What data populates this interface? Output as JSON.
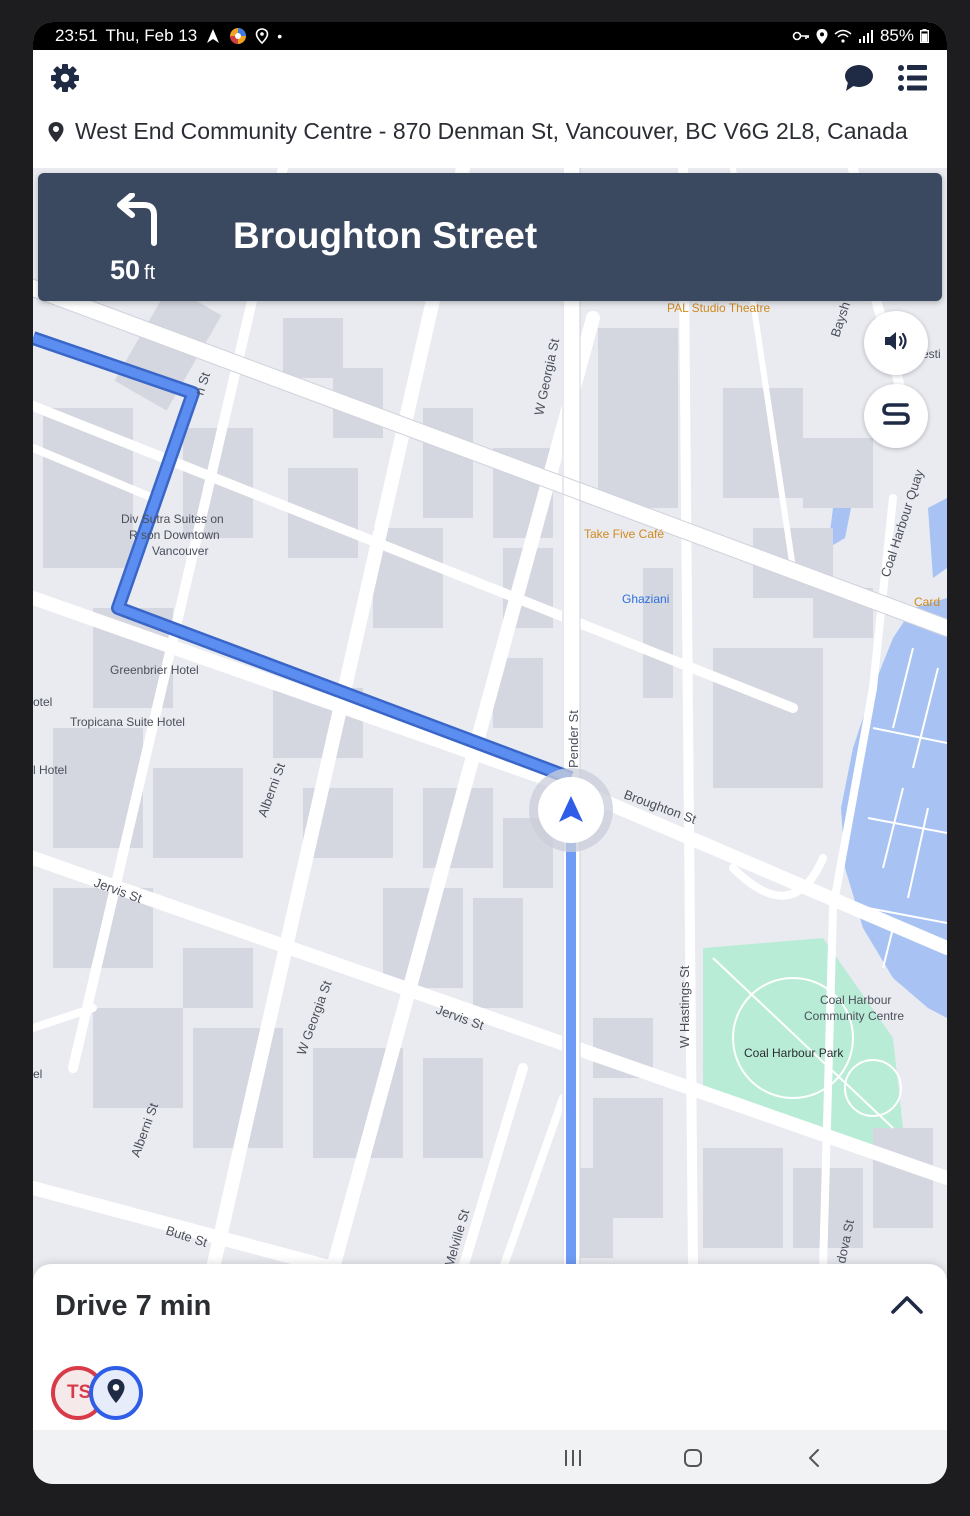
{
  "status_bar": {
    "time": "23:51",
    "date": "Thu, Feb 13",
    "battery": "85%"
  },
  "header": {
    "destination": "West End Community Centre - 870 Denman St, Vancouver, BC V6G 2L8, Canada"
  },
  "instruction": {
    "distance": "50",
    "unit": "ft",
    "street": "Broughton Street",
    "maneuver": "turn-left-icon"
  },
  "map_labels": {
    "street_georgia_top": "W Georgia St",
    "street_broughton": "Broughton St",
    "street_pender": "Pender St",
    "street_jervis_left": "Jervis St",
    "street_jervis_mid": "Jervis St",
    "street_alberni_mid": "Alberni St",
    "street_alberni_low": "Alberni St",
    "street_georgia_low": "W Georgia St",
    "street_bute": "Bute St",
    "street_melville": "Melville St",
    "street_hastings": "W Hastings St",
    "street_coal_quay": "Coal Harbour Quay",
    "street_cordova": "dova St",
    "street_n": "n St",
    "street_bays": "Baysh",
    "poi_pal": "PAL Studio Theatre",
    "poi_takefive": "Take Five Café",
    "poi_ghaziani": "Ghaziani",
    "poi_card": "Card",
    "poi_divya_1": "Div  Sutra Suites on",
    "poi_divya_2": "R  son Downtown",
    "poi_divya_3": "Vancouver",
    "poi_greenbrier": "Greenbrier Hotel",
    "poi_tropicana": "Tropicana Suite Hotel",
    "poi_hotel_a": "otel",
    "poi_hotel_b": "l Hotel",
    "poi_el": "el",
    "poi_west": "esti",
    "poi_chcc_1": "Coal Harbour",
    "poi_chcc_2": "Community Centre",
    "poi_chpark": "Coal Harbour Park"
  },
  "sheet": {
    "drive_label": "Drive 7 min",
    "stop_origin": "TS"
  },
  "colors": {
    "nav_card": "#3a4860",
    "route": "#5b8ef0",
    "water": "#a8c3f3",
    "park": "#b9ecd6",
    "origin_ring": "#d93a48",
    "dest_ring": "#2e5de8"
  }
}
